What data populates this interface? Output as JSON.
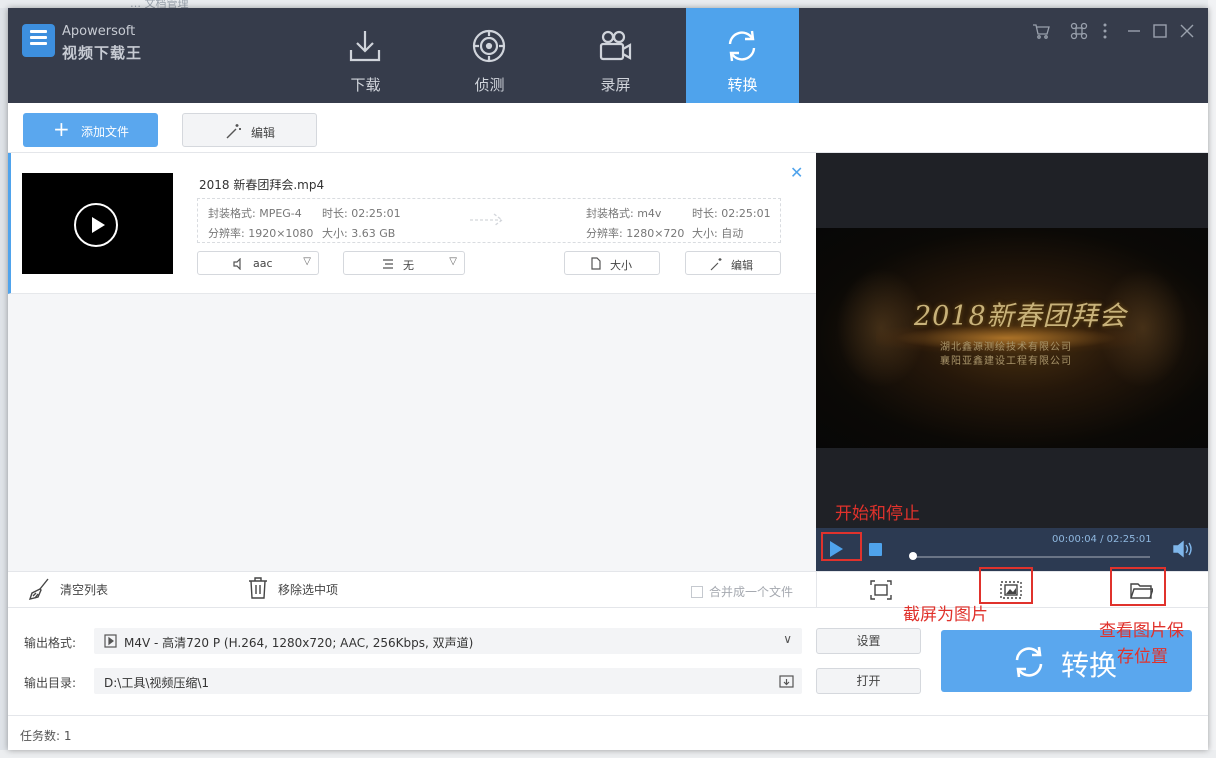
{
  "background": {
    "top_text": "… 文档管理"
  },
  "app": {
    "brand_en": "Apowersoft",
    "brand_cn": "视频下载王",
    "colors": {
      "header": "#363c4b",
      "accent": "#4fa3ec",
      "annotation": "#e0322c"
    }
  },
  "nav": {
    "tabs": [
      {
        "label": "下载",
        "icon": "download-icon"
      },
      {
        "label": "侦测",
        "icon": "detect-icon"
      },
      {
        "label": "录屏",
        "icon": "camera-icon"
      },
      {
        "label": "转换",
        "icon": "convert-icon",
        "active": true
      }
    ]
  },
  "window_controls": [
    "cart-icon",
    "command-icon",
    "more-icon",
    "minimize-icon",
    "maximize-icon",
    "close-icon"
  ],
  "toolbar": {
    "add_file": "添加文件",
    "edit": "编辑"
  },
  "file": {
    "name": "2018 新春团拜会.mp4",
    "source": {
      "format": "封装格式: MPEG-4",
      "duration": "时长: 02:25:01",
      "resolution": "分辨率: 1920×1080",
      "size": "大小: 3.63 GB"
    },
    "target": {
      "format": "封装格式: m4v",
      "duration": "时长: 02:25:01",
      "resolution": "分辨率: 1280×720",
      "size": "大小: 自动"
    },
    "audio": "aac",
    "subtitle": "无",
    "size_btn": "大小",
    "edit_btn": "编辑"
  },
  "list_footer": {
    "clear": "清空列表",
    "remove": "移除选中项",
    "merge": "合并成一个文件"
  },
  "preview": {
    "video_title": "2018新春团拜会",
    "video_sub1": "湖北鑫源测绘技术有限公司",
    "video_sub2": "襄阳亚鑫建设工程有限公司",
    "time": "00:00:04 / 02:25:01",
    "progress": 0.0005
  },
  "output": {
    "format_label": "输出格式:",
    "format_value": "M4V - 高清720 P (H.264, 1280x720; AAC, 256Kbps, 双声道)",
    "settings_btn": "设置",
    "dir_label": "输出目录:",
    "dir_value": "D:\\工具\\视频压缩\\1",
    "open_btn": "打开",
    "convert_btn": "转换"
  },
  "status": {
    "task_count": "任务数: 1"
  },
  "annotations": {
    "play_stop": "开始和停止",
    "screenshot": "截屏为图片",
    "view_location_1": "查看图片保",
    "view_location_2": "存位置"
  }
}
